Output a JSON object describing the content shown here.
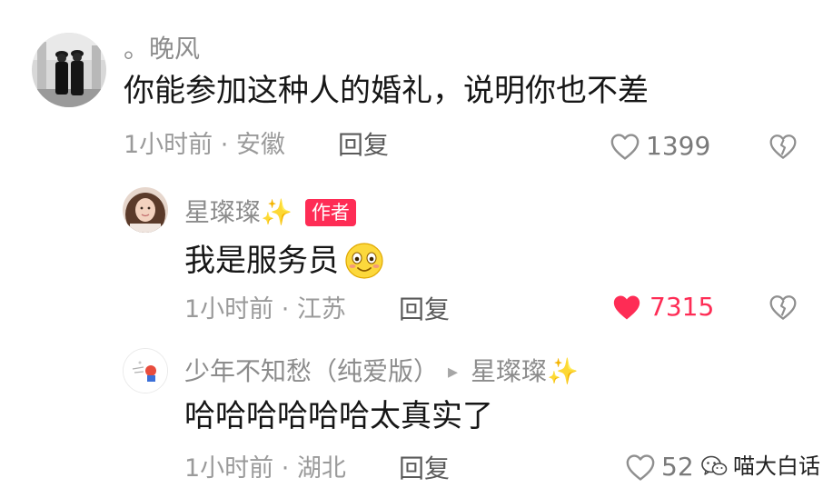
{
  "comments": [
    {
      "username": "。晚风",
      "text": "你能参加这种人的婚礼，说明你也不差",
      "time_location": "1小时前 · 安徽",
      "reply_label": "回复",
      "likes": "1399",
      "liked": false,
      "avatar_icon": "couple-photo-avatar"
    },
    {
      "username": "星璨璨",
      "username_emoji": "✨",
      "author_badge": "作者",
      "text": "我是服务员",
      "text_emoji": "smiling-face-emoji",
      "time_location": "1小时前 · 江苏",
      "reply_label": "回复",
      "likes": "7315",
      "liked": true,
      "avatar_icon": "girl-photo-avatar"
    },
    {
      "username": "少年不知愁（纯爱版）",
      "reply_to_arrow": "▸",
      "reply_to": "星璨璨",
      "reply_to_emoji": "✨",
      "text": "哈哈哈哈哈哈太真实了",
      "time_location": "1小时前 · 湖北",
      "reply_label": "回复",
      "likes": "52",
      "liked": false,
      "avatar_icon": "cartoon-avatar"
    }
  ],
  "watermark": {
    "text": "喵大白话",
    "icon": "wechat-icon"
  },
  "colors": {
    "like_active": "#fe2c55",
    "meta": "#9a9a9a",
    "name": "#8c8c8c",
    "text": "#161616"
  }
}
